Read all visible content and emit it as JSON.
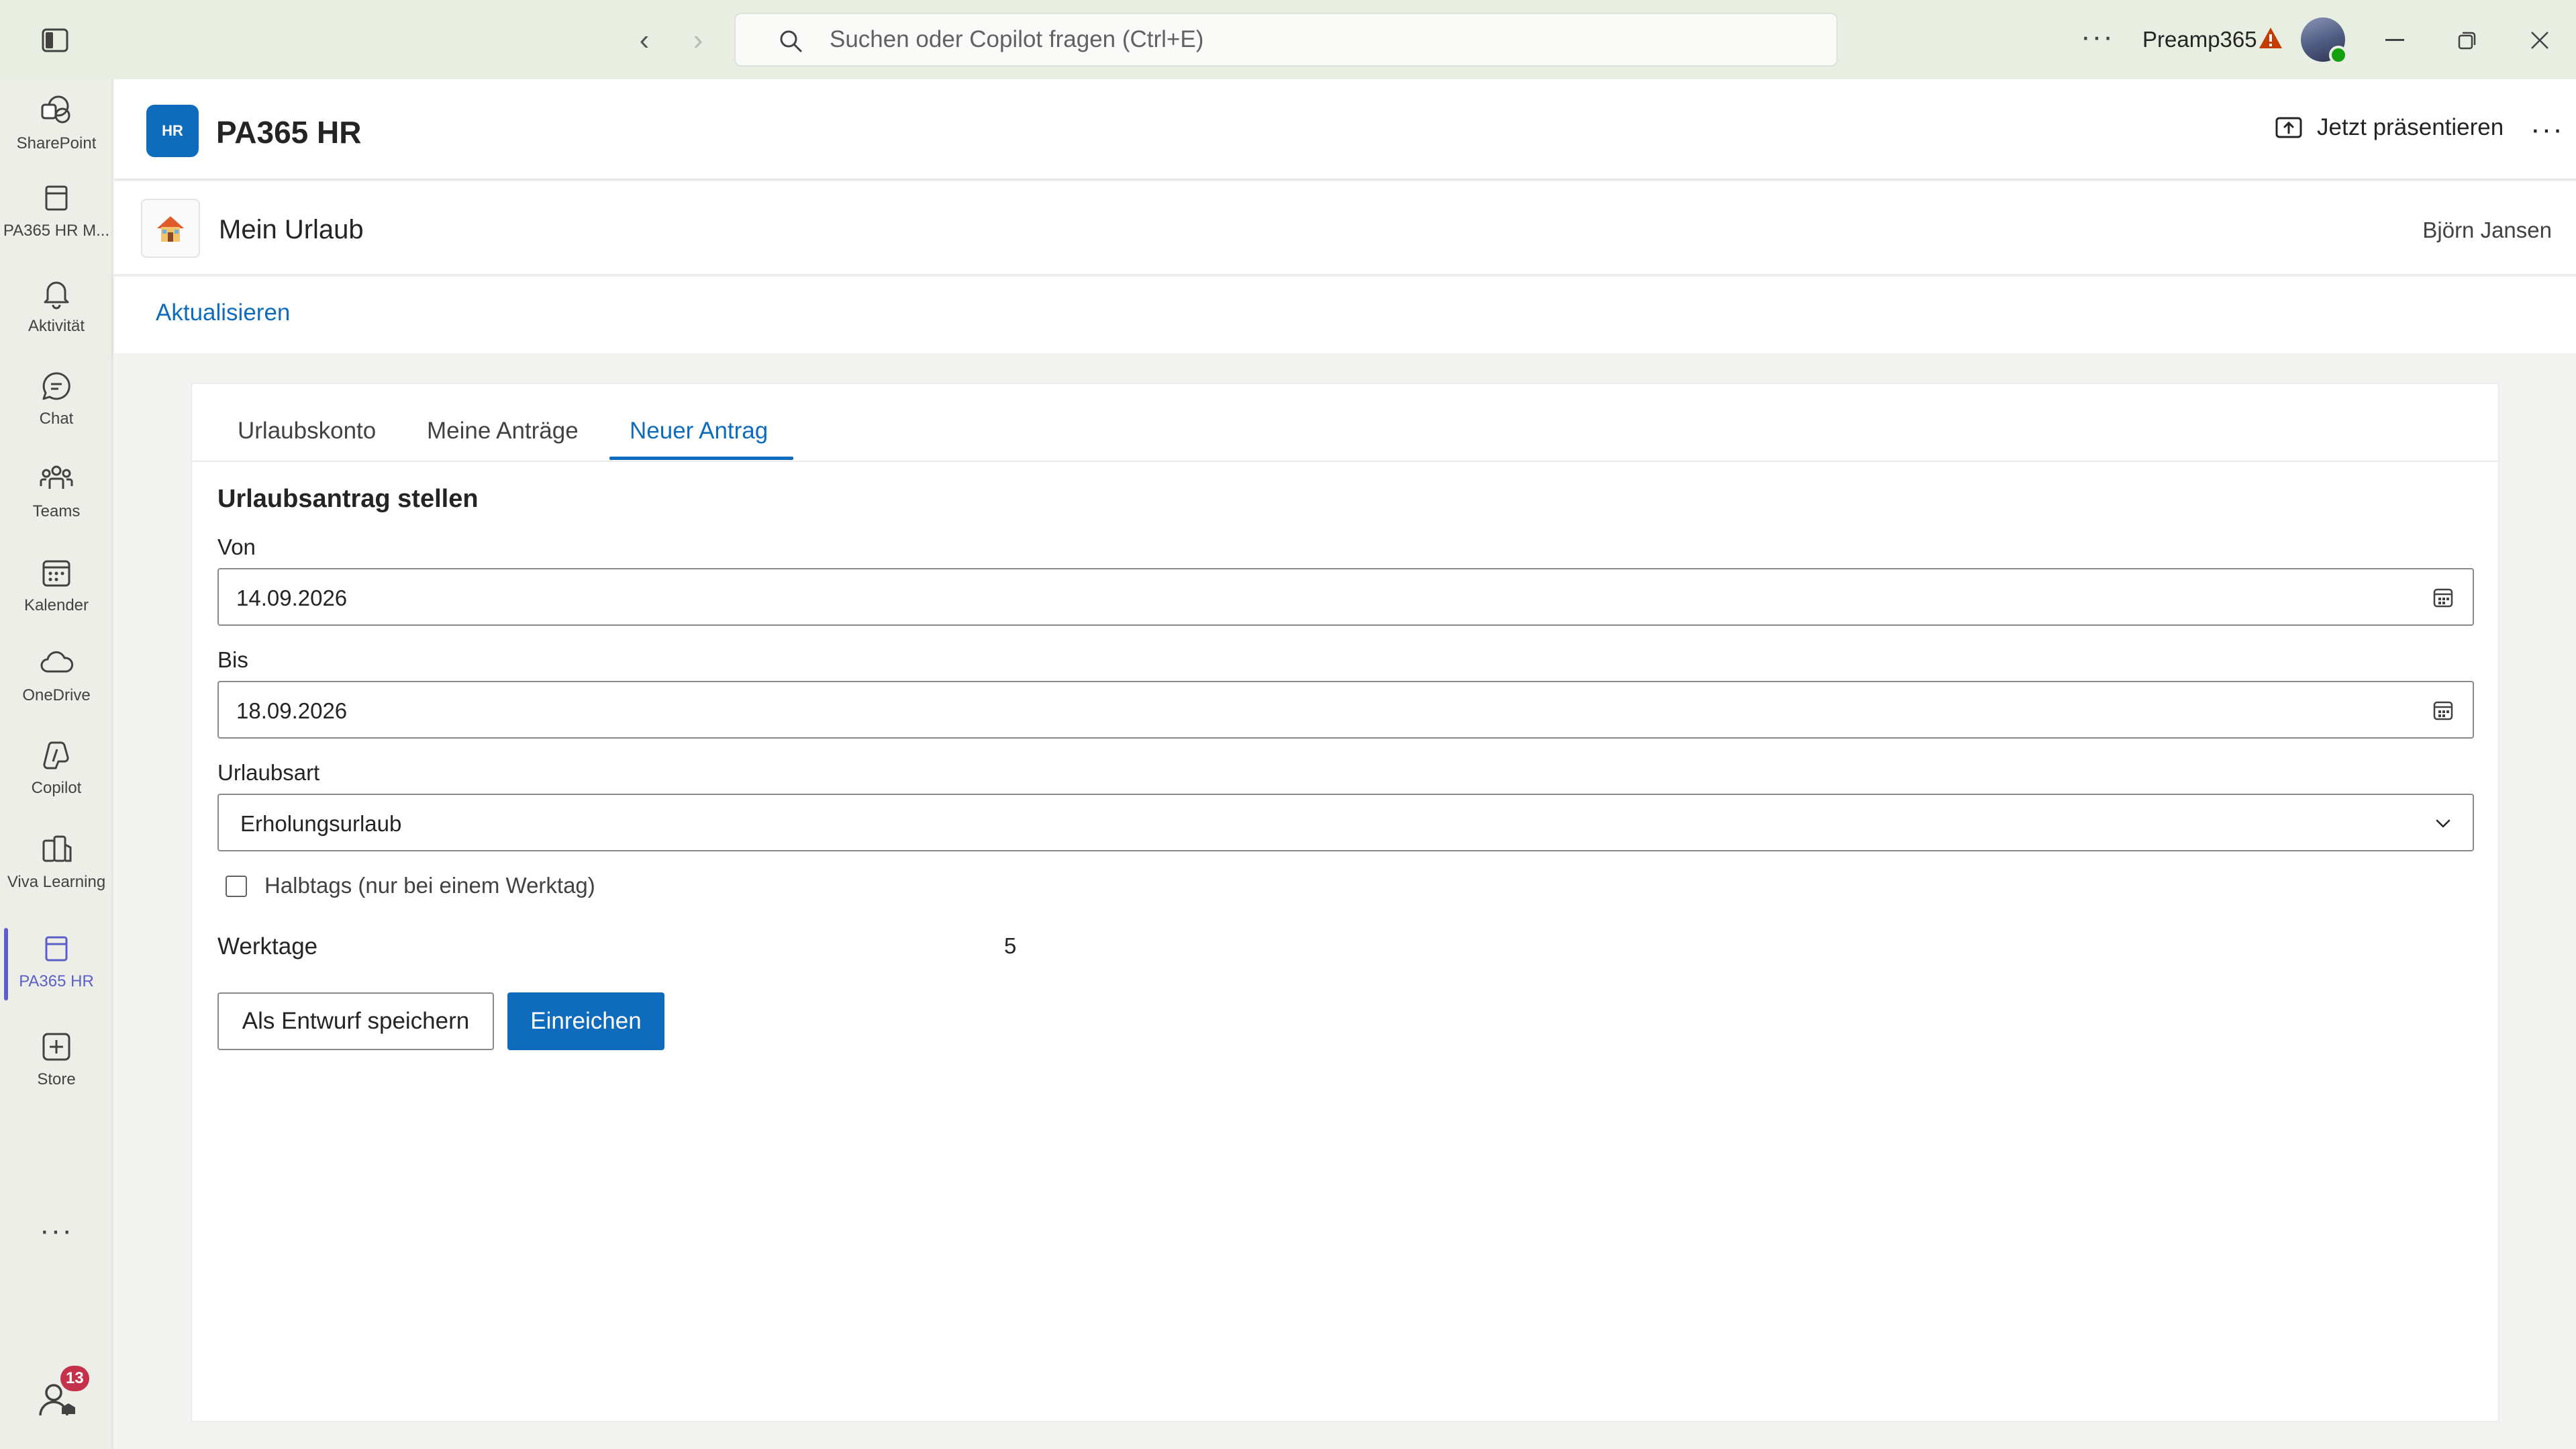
{
  "titlebar": {
    "search_placeholder": "Suchen oder Copilot fragen (Ctrl+E)",
    "org_name": "Preamp365",
    "more_label": "···"
  },
  "rail": {
    "items": [
      {
        "label": "SharePoint",
        "icon": "sharepoint-icon"
      },
      {
        "label": "PA365 HR M...",
        "icon": "app-window-icon"
      },
      {
        "label": "Aktivität",
        "icon": "bell-icon"
      },
      {
        "label": "Chat",
        "icon": "chat-icon"
      },
      {
        "label": "Teams",
        "icon": "teams-icon"
      },
      {
        "label": "Kalender",
        "icon": "calendar-icon"
      },
      {
        "label": "OneDrive",
        "icon": "cloud-icon"
      },
      {
        "label": "Copilot",
        "icon": "copilot-icon"
      },
      {
        "label": "Viva Learning",
        "icon": "book-icon"
      },
      {
        "label": "PA365 HR",
        "icon": "app-window-icon",
        "active": true
      },
      {
        "label": "Store",
        "icon": "store-add-icon"
      }
    ],
    "more_label": "···",
    "notification_count": "13"
  },
  "app": {
    "logo_text": "HR",
    "title": "PA365 HR",
    "present_label": "Jetzt präsentieren",
    "more_label": "···"
  },
  "page": {
    "title": "Mein Urlaub",
    "user": "Björn Jansen"
  },
  "command_bar": {
    "refresh_label": "Aktualisieren"
  },
  "tabs": [
    {
      "label": "Urlaubskonto"
    },
    {
      "label": "Meine Anträge"
    },
    {
      "label": "Neuer Antrag",
      "active": true
    }
  ],
  "form": {
    "title": "Urlaubsantrag stellen",
    "from": {
      "label": "Von",
      "value": "14.09.2026"
    },
    "to": {
      "label": "Bis",
      "value": "18.09.2026"
    },
    "type": {
      "label": "Urlaubsart",
      "value": "Erholungsurlaub"
    },
    "half_day": {
      "label": "Halbtags (nur bei einem Werktag)",
      "checked": false
    },
    "workdays": {
      "label": "Werktage",
      "value": "5"
    },
    "draft_button": "Als Entwurf speichern",
    "submit_button": "Einreichen"
  },
  "colors": {
    "accent": "#0f6cbd",
    "rail_active": "#5b5fc7",
    "badge": "#c4314b",
    "warning": "#c43c00"
  }
}
